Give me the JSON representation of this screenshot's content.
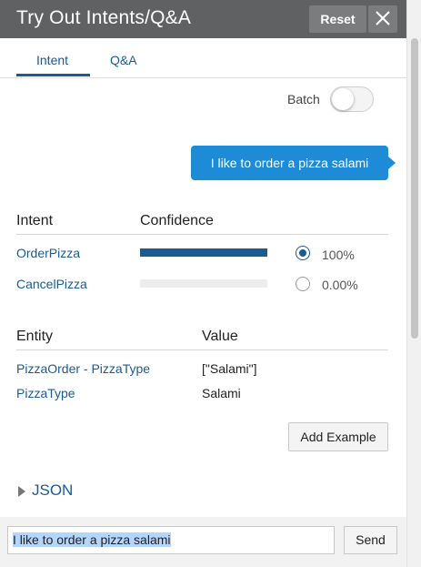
{
  "header": {
    "title": "Try Out Intents/Q&A",
    "reset_label": "Reset",
    "close_icon": "close-icon"
  },
  "tabs": [
    {
      "label": "Intent",
      "active": true
    },
    {
      "label": "Q&A",
      "active": false
    }
  ],
  "batch": {
    "label": "Batch",
    "enabled": false
  },
  "message": {
    "text": "I like to order a pizza salami"
  },
  "intents": {
    "headers": {
      "intent": "Intent",
      "confidence": "Confidence"
    },
    "rows": [
      {
        "name": "OrderPizza",
        "confidence": 1.0,
        "confidence_label": "100%",
        "selected": true
      },
      {
        "name": "CancelPizza",
        "confidence": 0.0,
        "confidence_label": "0.00%",
        "selected": false
      }
    ]
  },
  "entities": {
    "headers": {
      "entity": "Entity",
      "value": "Value"
    },
    "rows": [
      {
        "name": "PizzaOrder - PizzaType",
        "value": "[\"Salami\"]"
      },
      {
        "name": "PizzaType",
        "value": "Salami"
      }
    ]
  },
  "add_example_label": "Add Example",
  "json_label": "JSON",
  "input": {
    "value": "I like to order a pizza salami",
    "send_label": "Send"
  },
  "colors": {
    "header_bg": "#5f6163",
    "accent": "#1b5b93",
    "bubble": "#1d8bd6"
  }
}
